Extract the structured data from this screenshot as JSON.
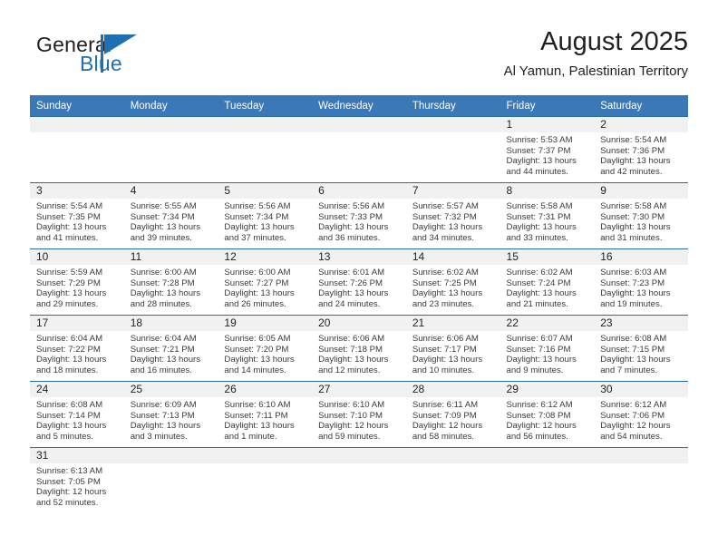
{
  "brand": {
    "name_part1": "General",
    "name_part2": "Blue",
    "triangle_color": "#1f6fb2"
  },
  "header": {
    "title": "August 2025",
    "subtitle": "Al Yamun, Palestinian Territory"
  },
  "theme": {
    "header_blue": "#3b78b8",
    "row_border_blue": "#2e6ca4",
    "daynum_bg": "#f1f1f1"
  },
  "weekdays": [
    "Sunday",
    "Monday",
    "Tuesday",
    "Wednesday",
    "Thursday",
    "Friday",
    "Saturday"
  ],
  "weeks": [
    [
      {
        "day": "",
        "empty": true,
        "sunrise": "",
        "sunset": "",
        "daylight1": "",
        "daylight2": ""
      },
      {
        "day": "",
        "empty": true,
        "sunrise": "",
        "sunset": "",
        "daylight1": "",
        "daylight2": ""
      },
      {
        "day": "",
        "empty": true,
        "sunrise": "",
        "sunset": "",
        "daylight1": "",
        "daylight2": ""
      },
      {
        "day": "",
        "empty": true,
        "sunrise": "",
        "sunset": "",
        "daylight1": "",
        "daylight2": ""
      },
      {
        "day": "",
        "empty": true,
        "sunrise": "",
        "sunset": "",
        "daylight1": "",
        "daylight2": ""
      },
      {
        "day": "1",
        "empty": false,
        "sunrise": "Sunrise: 5:53 AM",
        "sunset": "Sunset: 7:37 PM",
        "daylight1": "Daylight: 13 hours",
        "daylight2": "and 44 minutes."
      },
      {
        "day": "2",
        "empty": false,
        "sunrise": "Sunrise: 5:54 AM",
        "sunset": "Sunset: 7:36 PM",
        "daylight1": "Daylight: 13 hours",
        "daylight2": "and 42 minutes."
      }
    ],
    [
      {
        "day": "3",
        "empty": false,
        "sunrise": "Sunrise: 5:54 AM",
        "sunset": "Sunset: 7:35 PM",
        "daylight1": "Daylight: 13 hours",
        "daylight2": "and 41 minutes."
      },
      {
        "day": "4",
        "empty": false,
        "sunrise": "Sunrise: 5:55 AM",
        "sunset": "Sunset: 7:34 PM",
        "daylight1": "Daylight: 13 hours",
        "daylight2": "and 39 minutes."
      },
      {
        "day": "5",
        "empty": false,
        "sunrise": "Sunrise: 5:56 AM",
        "sunset": "Sunset: 7:34 PM",
        "daylight1": "Daylight: 13 hours",
        "daylight2": "and 37 minutes."
      },
      {
        "day": "6",
        "empty": false,
        "sunrise": "Sunrise: 5:56 AM",
        "sunset": "Sunset: 7:33 PM",
        "daylight1": "Daylight: 13 hours",
        "daylight2": "and 36 minutes."
      },
      {
        "day": "7",
        "empty": false,
        "sunrise": "Sunrise: 5:57 AM",
        "sunset": "Sunset: 7:32 PM",
        "daylight1": "Daylight: 13 hours",
        "daylight2": "and 34 minutes."
      },
      {
        "day": "8",
        "empty": false,
        "sunrise": "Sunrise: 5:58 AM",
        "sunset": "Sunset: 7:31 PM",
        "daylight1": "Daylight: 13 hours",
        "daylight2": "and 33 minutes."
      },
      {
        "day": "9",
        "empty": false,
        "sunrise": "Sunrise: 5:58 AM",
        "sunset": "Sunset: 7:30 PM",
        "daylight1": "Daylight: 13 hours",
        "daylight2": "and 31 minutes."
      }
    ],
    [
      {
        "day": "10",
        "empty": false,
        "sunrise": "Sunrise: 5:59 AM",
        "sunset": "Sunset: 7:29 PM",
        "daylight1": "Daylight: 13 hours",
        "daylight2": "and 29 minutes."
      },
      {
        "day": "11",
        "empty": false,
        "sunrise": "Sunrise: 6:00 AM",
        "sunset": "Sunset: 7:28 PM",
        "daylight1": "Daylight: 13 hours",
        "daylight2": "and 28 minutes."
      },
      {
        "day": "12",
        "empty": false,
        "sunrise": "Sunrise: 6:00 AM",
        "sunset": "Sunset: 7:27 PM",
        "daylight1": "Daylight: 13 hours",
        "daylight2": "and 26 minutes."
      },
      {
        "day": "13",
        "empty": false,
        "sunrise": "Sunrise: 6:01 AM",
        "sunset": "Sunset: 7:26 PM",
        "daylight1": "Daylight: 13 hours",
        "daylight2": "and 24 minutes."
      },
      {
        "day": "14",
        "empty": false,
        "sunrise": "Sunrise: 6:02 AM",
        "sunset": "Sunset: 7:25 PM",
        "daylight1": "Daylight: 13 hours",
        "daylight2": "and 23 minutes."
      },
      {
        "day": "15",
        "empty": false,
        "sunrise": "Sunrise: 6:02 AM",
        "sunset": "Sunset: 7:24 PM",
        "daylight1": "Daylight: 13 hours",
        "daylight2": "and 21 minutes."
      },
      {
        "day": "16",
        "empty": false,
        "sunrise": "Sunrise: 6:03 AM",
        "sunset": "Sunset: 7:23 PM",
        "daylight1": "Daylight: 13 hours",
        "daylight2": "and 19 minutes."
      }
    ],
    [
      {
        "day": "17",
        "empty": false,
        "sunrise": "Sunrise: 6:04 AM",
        "sunset": "Sunset: 7:22 PM",
        "daylight1": "Daylight: 13 hours",
        "daylight2": "and 18 minutes."
      },
      {
        "day": "18",
        "empty": false,
        "sunrise": "Sunrise: 6:04 AM",
        "sunset": "Sunset: 7:21 PM",
        "daylight1": "Daylight: 13 hours",
        "daylight2": "and 16 minutes."
      },
      {
        "day": "19",
        "empty": false,
        "sunrise": "Sunrise: 6:05 AM",
        "sunset": "Sunset: 7:20 PM",
        "daylight1": "Daylight: 13 hours",
        "daylight2": "and 14 minutes."
      },
      {
        "day": "20",
        "empty": false,
        "sunrise": "Sunrise: 6:06 AM",
        "sunset": "Sunset: 7:18 PM",
        "daylight1": "Daylight: 13 hours",
        "daylight2": "and 12 minutes."
      },
      {
        "day": "21",
        "empty": false,
        "sunrise": "Sunrise: 6:06 AM",
        "sunset": "Sunset: 7:17 PM",
        "daylight1": "Daylight: 13 hours",
        "daylight2": "and 10 minutes."
      },
      {
        "day": "22",
        "empty": false,
        "sunrise": "Sunrise: 6:07 AM",
        "sunset": "Sunset: 7:16 PM",
        "daylight1": "Daylight: 13 hours",
        "daylight2": "and 9 minutes."
      },
      {
        "day": "23",
        "empty": false,
        "sunrise": "Sunrise: 6:08 AM",
        "sunset": "Sunset: 7:15 PM",
        "daylight1": "Daylight: 13 hours",
        "daylight2": "and 7 minutes."
      }
    ],
    [
      {
        "day": "24",
        "empty": false,
        "sunrise": "Sunrise: 6:08 AM",
        "sunset": "Sunset: 7:14 PM",
        "daylight1": "Daylight: 13 hours",
        "daylight2": "and 5 minutes."
      },
      {
        "day": "25",
        "empty": false,
        "sunrise": "Sunrise: 6:09 AM",
        "sunset": "Sunset: 7:13 PM",
        "daylight1": "Daylight: 13 hours",
        "daylight2": "and 3 minutes."
      },
      {
        "day": "26",
        "empty": false,
        "sunrise": "Sunrise: 6:10 AM",
        "sunset": "Sunset: 7:11 PM",
        "daylight1": "Daylight: 13 hours",
        "daylight2": "and 1 minute."
      },
      {
        "day": "27",
        "empty": false,
        "sunrise": "Sunrise: 6:10 AM",
        "sunset": "Sunset: 7:10 PM",
        "daylight1": "Daylight: 12 hours",
        "daylight2": "and 59 minutes."
      },
      {
        "day": "28",
        "empty": false,
        "sunrise": "Sunrise: 6:11 AM",
        "sunset": "Sunset: 7:09 PM",
        "daylight1": "Daylight: 12 hours",
        "daylight2": "and 58 minutes."
      },
      {
        "day": "29",
        "empty": false,
        "sunrise": "Sunrise: 6:12 AM",
        "sunset": "Sunset: 7:08 PM",
        "daylight1": "Daylight: 12 hours",
        "daylight2": "and 56 minutes."
      },
      {
        "day": "30",
        "empty": false,
        "sunrise": "Sunrise: 6:12 AM",
        "sunset": "Sunset: 7:06 PM",
        "daylight1": "Daylight: 12 hours",
        "daylight2": "and 54 minutes."
      }
    ],
    [
      {
        "day": "31",
        "empty": false,
        "sunrise": "Sunrise: 6:13 AM",
        "sunset": "Sunset: 7:05 PM",
        "daylight1": "Daylight: 12 hours",
        "daylight2": "and 52 minutes."
      },
      {
        "day": "",
        "empty": true,
        "sunrise": "",
        "sunset": "",
        "daylight1": "",
        "daylight2": ""
      },
      {
        "day": "",
        "empty": true,
        "sunrise": "",
        "sunset": "",
        "daylight1": "",
        "daylight2": ""
      },
      {
        "day": "",
        "empty": true,
        "sunrise": "",
        "sunset": "",
        "daylight1": "",
        "daylight2": ""
      },
      {
        "day": "",
        "empty": true,
        "sunrise": "",
        "sunset": "",
        "daylight1": "",
        "daylight2": ""
      },
      {
        "day": "",
        "empty": true,
        "sunrise": "",
        "sunset": "",
        "daylight1": "",
        "daylight2": ""
      },
      {
        "day": "",
        "empty": true,
        "sunrise": "",
        "sunset": "",
        "daylight1": "",
        "daylight2": ""
      }
    ]
  ]
}
